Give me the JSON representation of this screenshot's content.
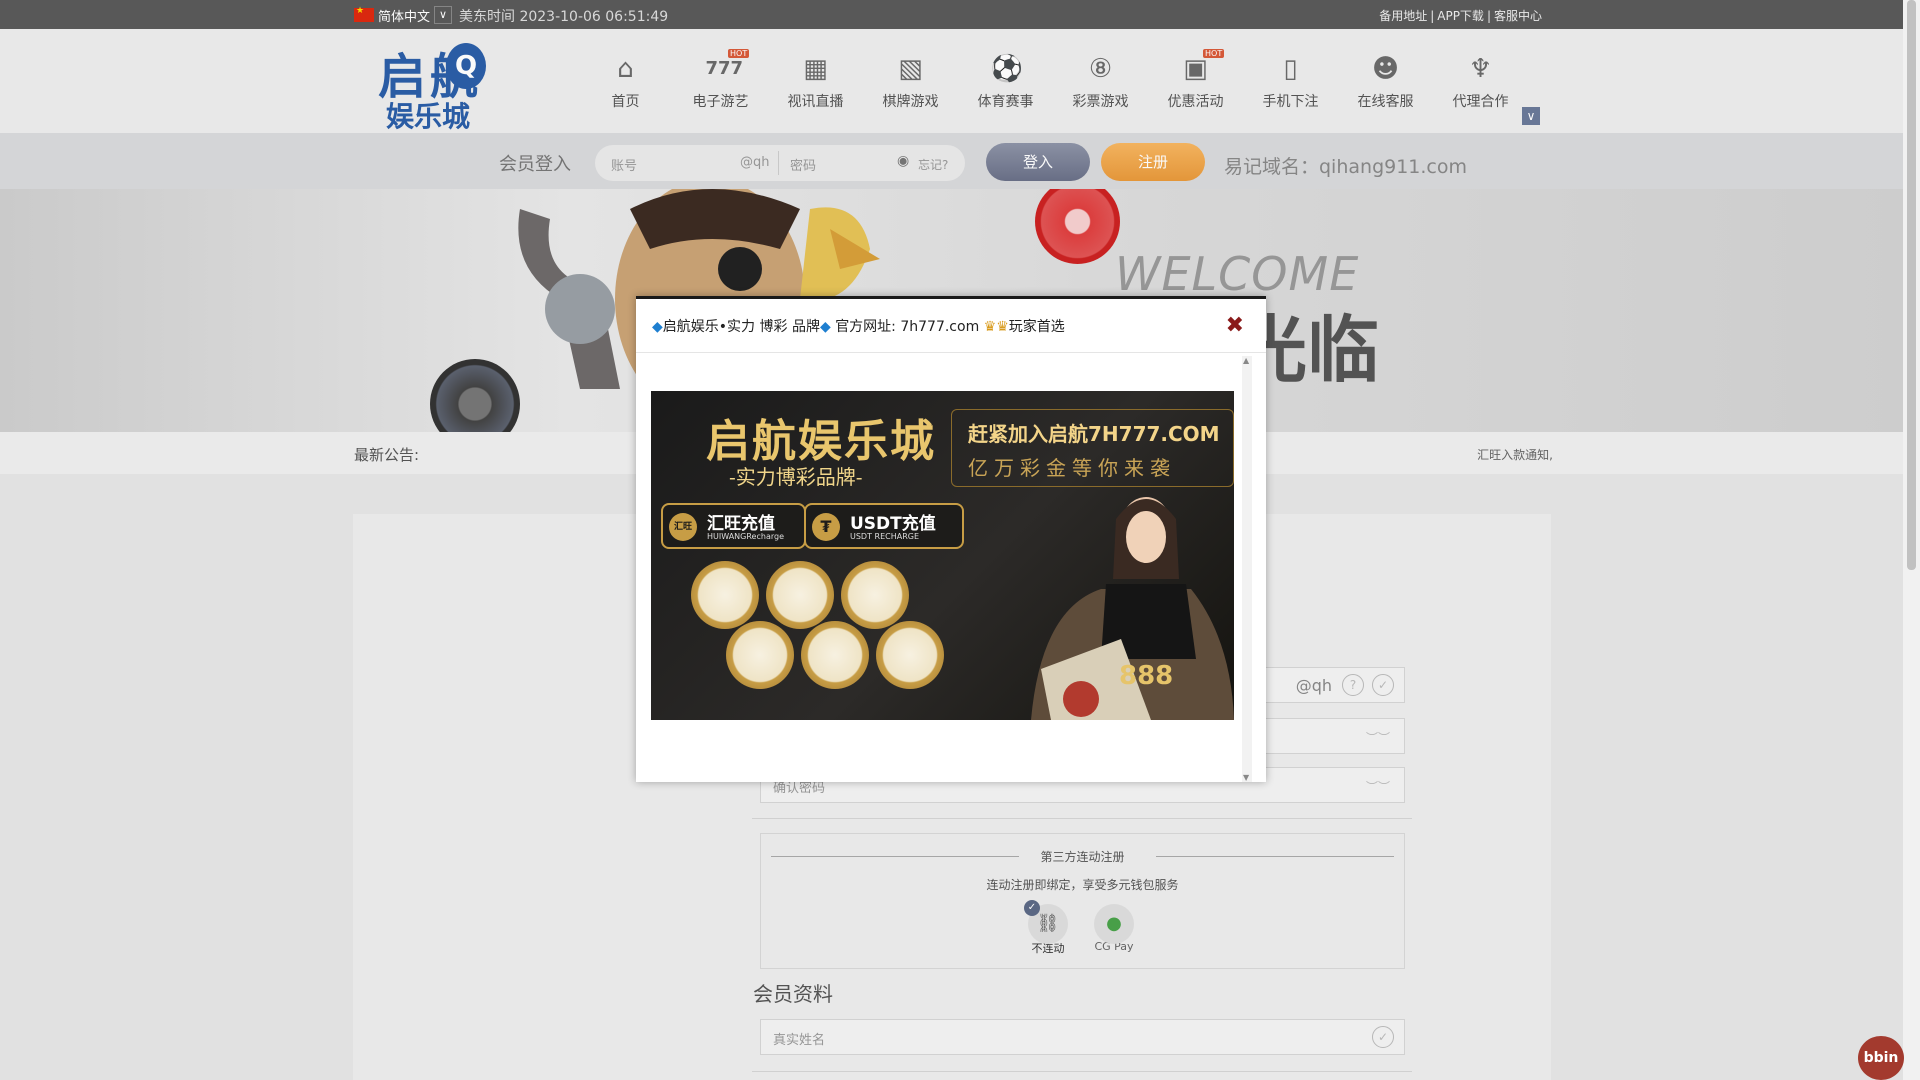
{
  "topbar": {
    "language": "简体中文",
    "us_time_label": "美东时间",
    "us_time_value": "2023-10-06 06:51:49",
    "links": [
      "备用地址",
      "APP下载",
      "客服中心"
    ]
  },
  "header": {
    "logo_text_top": "启航",
    "logo_letter": "Q",
    "logo_text_bottom": "娱乐城",
    "nav": [
      {
        "label": "首页",
        "icon": "home-icon",
        "hot": false
      },
      {
        "label": "电子游艺",
        "icon": "slot-777-icon",
        "hot": true
      },
      {
        "label": "视讯直播",
        "icon": "film-icon",
        "hot": false
      },
      {
        "label": "棋牌游戏",
        "icon": "cards-icon",
        "hot": false
      },
      {
        "label": "体育赛事",
        "icon": "soccer-ball-icon",
        "hot": false
      },
      {
        "label": "彩票游戏",
        "icon": "lottery-ball-icon",
        "hot": false
      },
      {
        "label": "优惠活动",
        "icon": "gift-icon",
        "hot": true
      },
      {
        "label": "手机下注",
        "icon": "mobile-icon",
        "hot": false
      },
      {
        "label": "在线客服",
        "icon": "support-agent-icon",
        "hot": false
      },
      {
        "label": "代理合作",
        "icon": "handshake-icon",
        "hot": false
      }
    ],
    "hot_badge": "HOT"
  },
  "login": {
    "label": "会员登入",
    "account_placeholder": "账号",
    "account_suffix": "@qh",
    "password_placeholder": "密码",
    "forgot": "忘记?",
    "login_button": "登入",
    "register_button": "注册",
    "easy_domain": "易记域名：qihang911.com"
  },
  "banner": {
    "welcome": "WELCOME",
    "welcome_cn": "光临"
  },
  "notice": {
    "label": "最新公告:",
    "text": "汇旺入款通知,"
  },
  "form": {
    "account_suffix": "@qh",
    "confirm_password_placeholder": "确认密码",
    "third_party_title": "第三方连动注册",
    "third_party_sub": "连动注册即绑定，享受多元钱包服务",
    "option_nolink": "不连动",
    "option_cgpay": "CG Pay",
    "member_info_title": "会员资料",
    "real_name_placeholder": "真实姓名"
  },
  "modal": {
    "title_part1": "启航娱乐•实力 博彩 品牌",
    "title_part2": "官方网址:",
    "title_url": "7h777.com",
    "title_part3": "玩家首选",
    "promo": {
      "brand": "启航娱乐城",
      "slogan": "-实力博彩品牌-",
      "right_line1": "赶紧加入启航7H777.COM",
      "right_line2": "亿万彩金等你来袭",
      "pay1_title": "汇旺充值",
      "pay1_sub": "HUIWANGRecharge",
      "pay1_icon": "汇旺",
      "pay2_title": "USDT充值",
      "pay2_sub": "USDT RECHARGE",
      "pay2_icon": "₮",
      "number": "888"
    }
  },
  "bbin": "bbin"
}
